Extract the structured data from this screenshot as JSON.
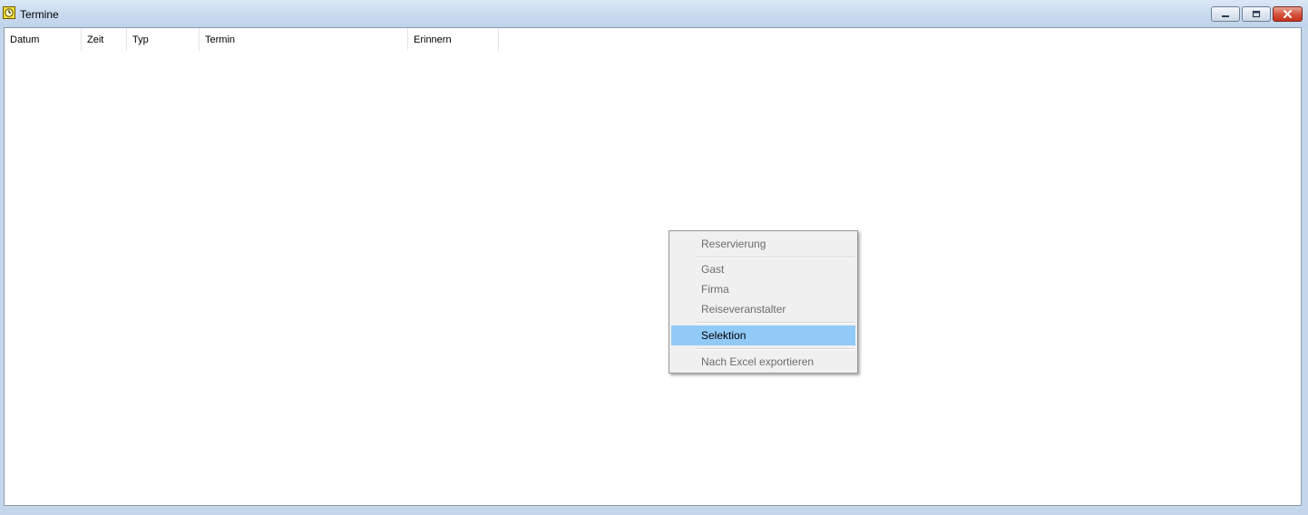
{
  "window": {
    "title": "Termine",
    "icon": "clock-icon",
    "controls": {
      "minimize": "minimize-icon",
      "maximize": "maximize-icon",
      "close": "close-icon"
    }
  },
  "list": {
    "columns": [
      "Datum",
      "Zeit",
      "Typ",
      "Termin",
      "Erinnern"
    ],
    "rows": []
  },
  "context_menu": {
    "items": [
      {
        "label": "Reservierung",
        "enabled": false
      },
      {
        "label": "Gast",
        "enabled": false
      },
      {
        "label": "Firma",
        "enabled": false
      },
      {
        "label": "Reiseveranstalter",
        "enabled": false
      },
      {
        "label": "Selektion",
        "enabled": true,
        "highlighted": true
      },
      {
        "label": "Nach Excel exportieren",
        "enabled": false
      }
    ],
    "highlight_color": "#91c9f7",
    "disabled_text_color": "#6d6d6d"
  }
}
